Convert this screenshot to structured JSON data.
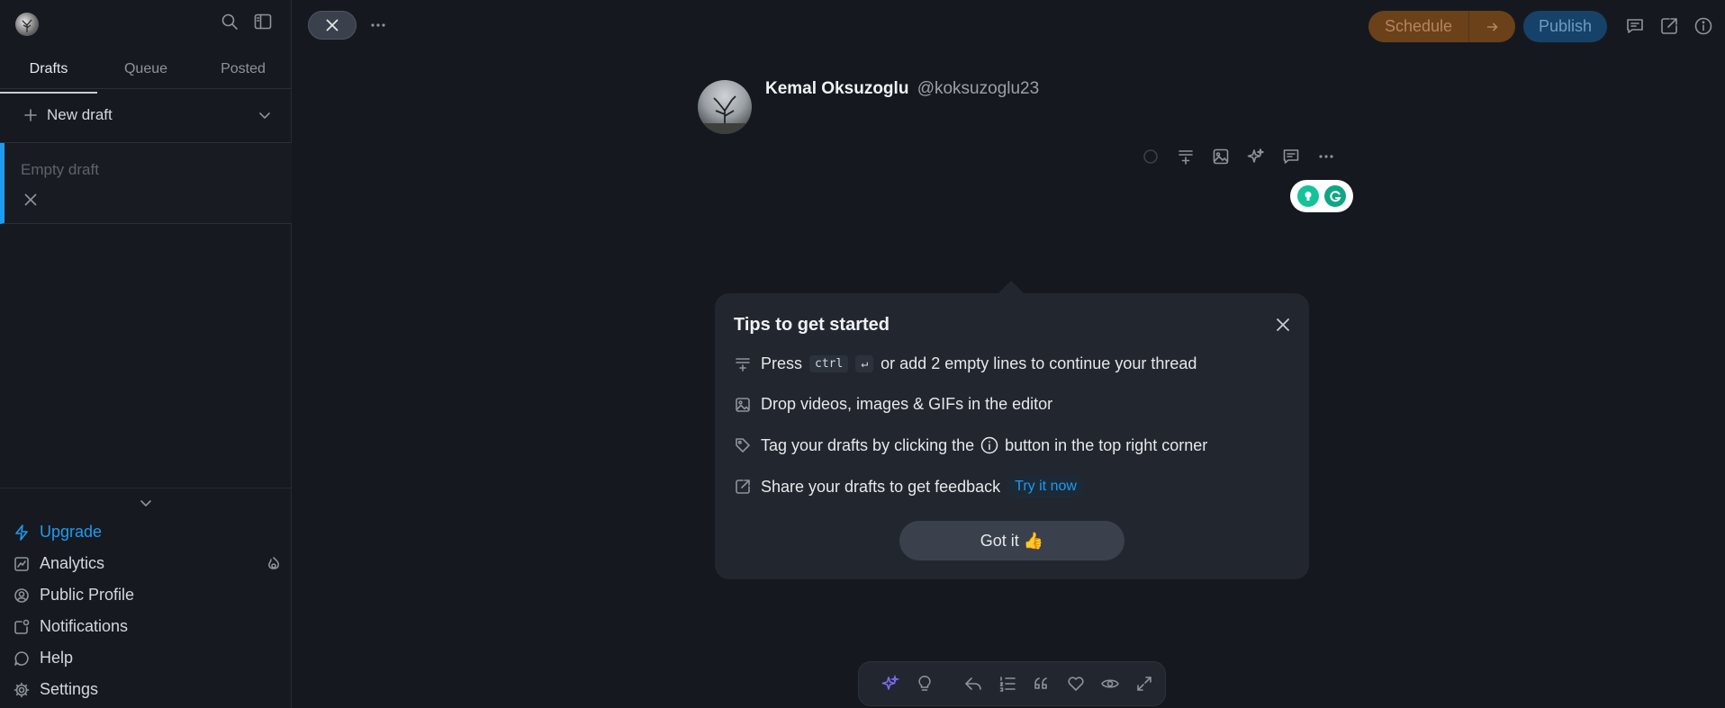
{
  "sidebar": {
    "tabs": [
      {
        "label": "Drafts",
        "active": true
      },
      {
        "label": "Queue",
        "active": false
      },
      {
        "label": "Posted",
        "active": false
      }
    ],
    "new_draft_label": "New draft",
    "draft_item": {
      "title": "Empty draft",
      "platform_icon": "x-logo-icon"
    },
    "nav": {
      "upgrade": "Upgrade",
      "analytics": "Analytics",
      "public_profile": "Public Profile",
      "notifications": "Notifications",
      "help": "Help",
      "settings": "Settings"
    }
  },
  "topbar": {
    "schedule_label": "Schedule",
    "publish_label": "Publish"
  },
  "author": {
    "name": "Kemal Oksuzoglu",
    "handle": "@koksuzoglu23"
  },
  "tips": {
    "title": "Tips to get started",
    "row1": {
      "before": "Press",
      "key1": "ctrl",
      "key2": "↵",
      "after": "or add 2 empty lines to continue your thread"
    },
    "row2": {
      "text": "Drop videos, images & GIFs in the editor"
    },
    "row3": {
      "before": "Tag your drafts by clicking the",
      "after": "button in the top right corner"
    },
    "row4": {
      "text": "Share your drafts to get feedback",
      "link": "Try it now"
    },
    "button": "Got it 👍"
  },
  "colors": {
    "accent": "#1d9bf0",
    "schedule_bg": "#6b4119",
    "publish_bg": "#16426a",
    "background": "#15191f",
    "popup_bg": "#22272f"
  }
}
